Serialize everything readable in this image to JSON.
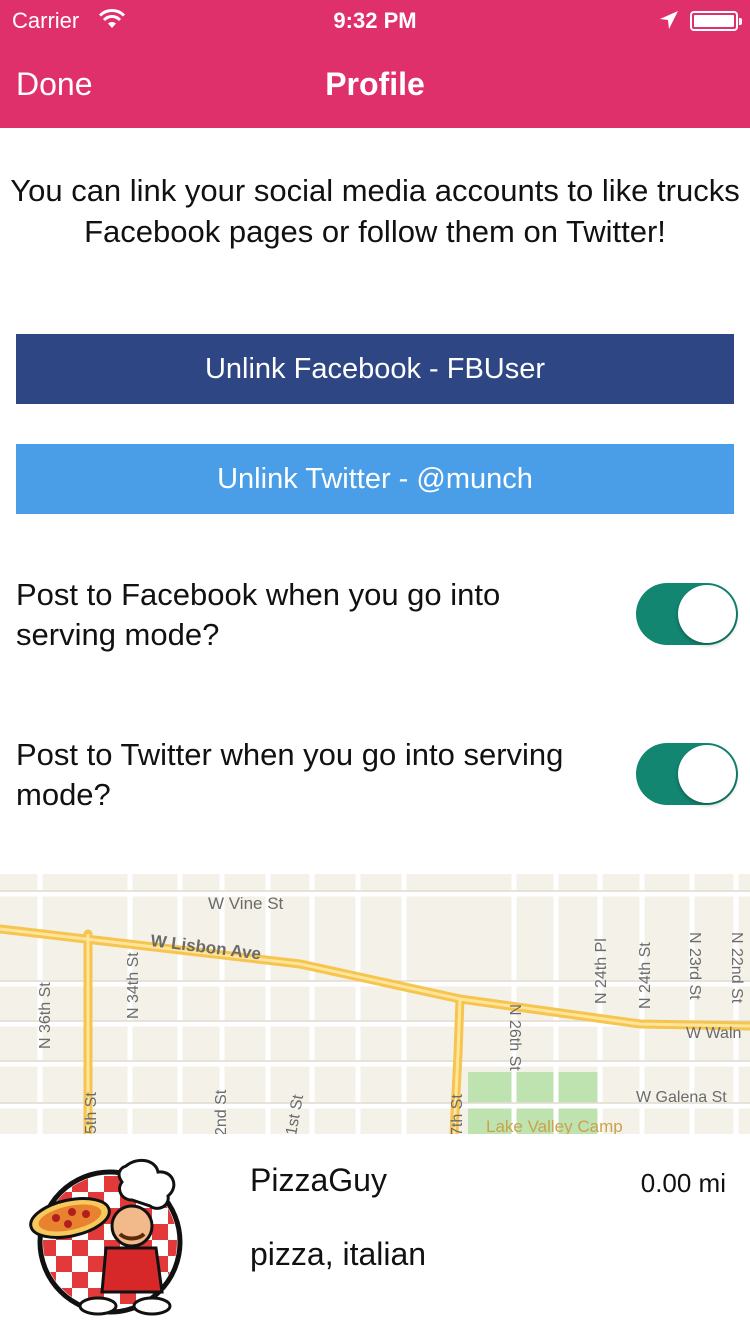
{
  "status_bar": {
    "carrier": "Carrier",
    "time": "9:32 PM"
  },
  "nav": {
    "done_label": "Done",
    "title": "Profile",
    "background_color": "#e0306c"
  },
  "intro_text": "You can link your social media accounts to like trucks Facebook pages or follow them on Twitter!",
  "buttons": {
    "facebook_label": "Unlink Facebook - FBUser",
    "facebook_color": "#2e4684",
    "twitter_label": "Unlink Twitter - @munch",
    "twitter_color": "#4a9ee8"
  },
  "settings": [
    {
      "label": "Post to Facebook when you go into serving mode?",
      "on": true
    },
    {
      "label": "Post to Twitter when you go into serving mode?",
      "on": true
    }
  ],
  "toggle_color": "#138672",
  "map": {
    "streets": {
      "w_vine": "W Vine St",
      "w_lisbon": "W Lisbon Ave",
      "n_36th": "N 36th St",
      "n_34th": "N 34th St",
      "n_26th": "N 26th St",
      "n_24th_pl": "N 24th Pl",
      "n_24th": "N 24th St",
      "n_23rd": "N 23rd St",
      "n_22nd": "N 22nd St",
      "w_walnut": "W Waln",
      "w_galena": "W Galena St",
      "s5th": "5th St",
      "s2nd": "2nd St",
      "s1st": "1st St",
      "s7th": "7th St",
      "park": "Lake Valley Camp"
    }
  },
  "truck": {
    "name": "PizzaGuy",
    "tags": "pizza, italian",
    "distance": "0.00 mi",
    "logo_icon": "pizza-guy-logo"
  }
}
